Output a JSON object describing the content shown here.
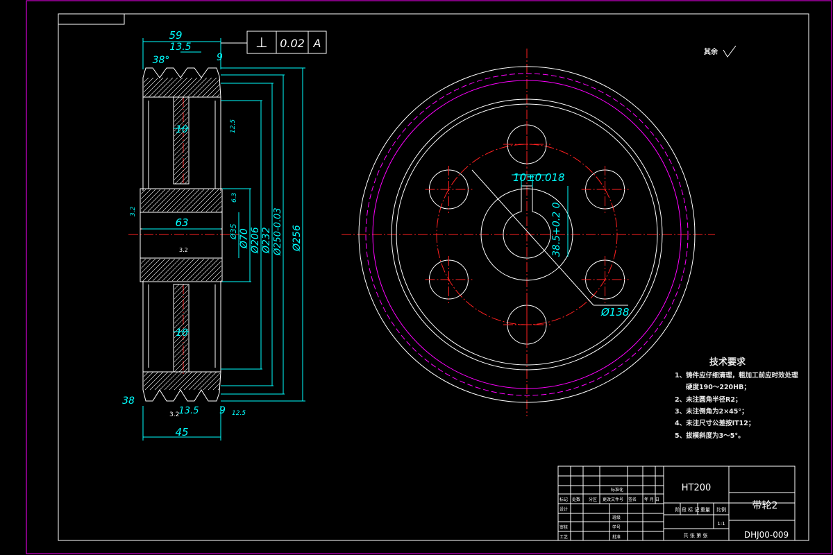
{
  "drawing": {
    "title": "带轮2",
    "drawing_number": "DHJ00-009",
    "material": "HT200",
    "scale": "1:1"
  },
  "dimensions": {
    "width_overall": "59",
    "groove_pitch": "13.5",
    "groove_edge": "9",
    "groove_angle_top": "38°",
    "groove_angle_bottom": "38",
    "hub_length": "63",
    "web_thickness_top": "10",
    "web_thickness_bottom": "10",
    "face_width": "45",
    "dia_70": "Ø70",
    "dia_206": "Ø206",
    "dia_232": "Ø232",
    "dia_250": "Ø250-0.03",
    "dia_256": "Ø256",
    "bore": "Ø35",
    "keyway_width": "10±0.018",
    "keyway_depth": "38.5+0.2 0",
    "hole_circle": "Ø138",
    "edge_bottom": "9",
    "groove_bottom_pitch": "13.5",
    "roughness_a": "3.2",
    "roughness_b": "12.5",
    "roughness_c": "6.3"
  },
  "tolerance_frame": {
    "symbol": "⊥",
    "value": "0.02",
    "datum": "A"
  },
  "surface_note": "其余",
  "tech_requirements": {
    "title": "技术要求",
    "items": [
      "1、铸件应仔细清理，粗加工前应时效处理",
      "硬度190～220HB；",
      "2、未注圆角半径R2；",
      "3、未注倒角为2×45°；",
      "4、未注尺寸公差按IT12；",
      "5、拔模斜度为3～5°。"
    ]
  },
  "title_block": {
    "row_mark": "标记",
    "row_count": "处数",
    "row_zone": "分区",
    "row_doc": "更改文件号",
    "row_sign": "签名",
    "row_date": "年 月 日",
    "design": "设计",
    "standardize": "标准化",
    "review": "审核",
    "process": "工艺",
    "class": "班级",
    "student_no": "学号",
    "approve": "批准",
    "stage": "阶 段 标 记",
    "weight": "重量",
    "ratio": "比例",
    "sheets": "共    张  第    张"
  }
}
